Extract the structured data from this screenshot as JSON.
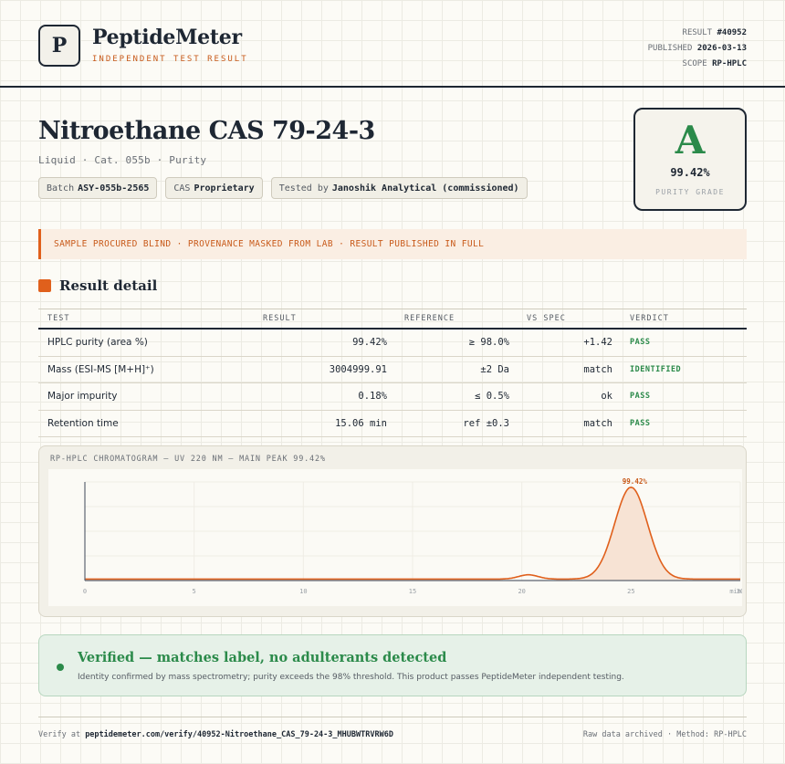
{
  "header": {
    "logo_letter": "P",
    "brand": "PeptideMeter",
    "brand_sub": "INDEPENDENT TEST RESULT",
    "result_label": "RESULT",
    "result_value": "#40952",
    "published_label": "PUBLISHED",
    "published_value": "2026-03-13",
    "scope_label": "SCOPE",
    "scope_value": "RP-HPLC"
  },
  "product": {
    "title": "Nitroethane CAS 79-24-3",
    "subtitle": "Liquid · Cat. 055b · Purity",
    "chips": [
      {
        "label": "Batch",
        "value": "ASY-055b-2565"
      },
      {
        "label": "CAS",
        "value": "Proprietary"
      },
      {
        "label": "Tested by",
        "value": "Janoshik Analytical (commissioned)"
      }
    ]
  },
  "grade": {
    "letter": "A",
    "value": "99.42%",
    "label": "PURITY GRADE"
  },
  "banner": "SAMPLE PROCURED BLIND · PROVENANCE MASKED FROM LAB · RESULT PUBLISHED IN FULL",
  "section_title": "Result detail",
  "table": {
    "headers": [
      "TEST",
      "RESULT",
      "REFERENCE",
      "VS SPEC",
      "VERDICT"
    ],
    "rows": [
      {
        "test": "HPLC purity (area %)",
        "result": "99.42%",
        "reference": "≥ 98.0%",
        "spec": "+1.42",
        "verdict": "PASS"
      },
      {
        "test": "Mass (ESI-MS [M+H]⁺)",
        "result": "3004999.91",
        "reference": "±2 Da",
        "spec": "match",
        "verdict": "IDENTIFIED"
      },
      {
        "test": "Major impurity",
        "result": "0.18%",
        "reference": "≤ 0.5%",
        "spec": "ok",
        "verdict": "PASS"
      },
      {
        "test": "Retention time",
        "result": "15.06 min",
        "reference": "ref ±0.3",
        "spec": "match",
        "verdict": "PASS"
      }
    ]
  },
  "chart_data": {
    "type": "line",
    "title": "RP-HPLC CHROMATOGRAM — UV 220 NM — MAIN PEAK 99.42%",
    "xlabel": "",
    "ylabel": "",
    "xlim": [
      0,
      30
    ],
    "x_ticks": [
      "0",
      "5",
      "10",
      "15",
      "20",
      "25",
      "30"
    ],
    "x_unit": "min",
    "baseline": 0.015,
    "peaks": [
      {
        "center": 20.3,
        "height": 0.045,
        "width": 0.45
      },
      {
        "center": 25.0,
        "height": 0.96,
        "width": 0.75,
        "label": "99.42%"
      }
    ],
    "grid": true,
    "colors": {
      "line": "#e0601c",
      "fill": "#f7e3d4",
      "axis": "#5c6370"
    }
  },
  "verified": {
    "title": "Verified — matches label, no adulterants detected",
    "text": "Identity confirmed by mass spectrometry; purity exceeds the 98% threshold. This product passes PeptideMeter independent testing."
  },
  "footer": {
    "verify_label": "Verify at",
    "verify_url": "peptidemeter.com/verify/40952-Nitroethane_CAS_79-24-3_MHUBWTRVRW6D",
    "right": "Raw data archived · Method: RP-HPLC"
  }
}
